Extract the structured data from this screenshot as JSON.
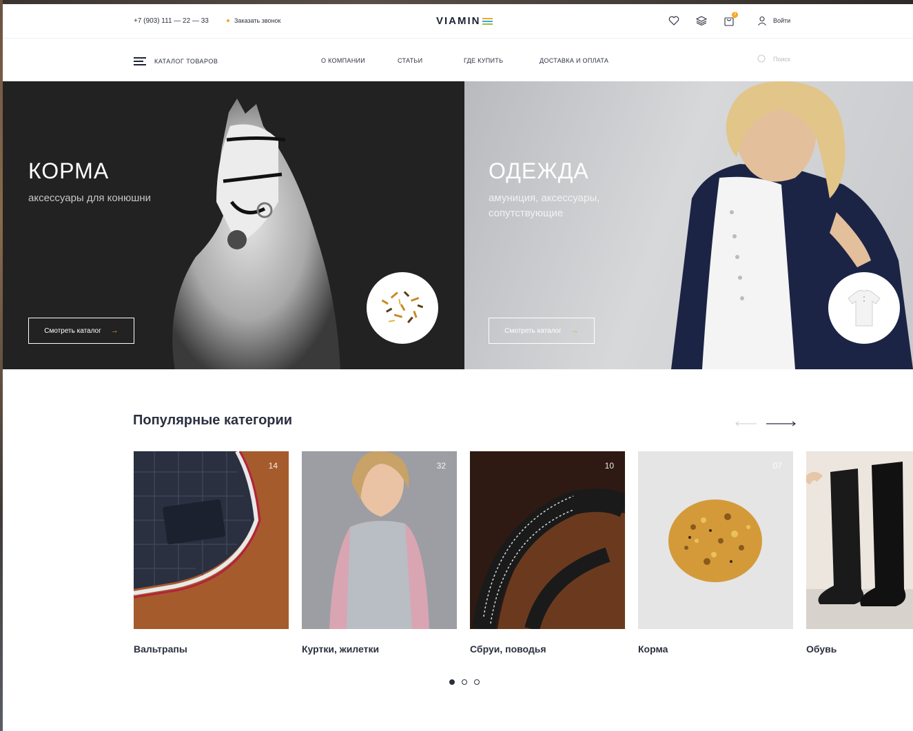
{
  "header": {
    "phone": "+7 (903) 111 — 22 — 33",
    "callback": "Заказать звонок",
    "logo": "VIAMIN",
    "logo_colors": [
      "#f5a623",
      "#35a9e0",
      "#8cc63f"
    ],
    "cart_count": "2",
    "login": "Войти",
    "icons": [
      "heart-icon",
      "layers-icon",
      "cart-icon",
      "user-icon"
    ]
  },
  "nav": {
    "catalog": "КАТАЛОГ ТОВАРОВ",
    "items": [
      "О КОМПАНИИ",
      "СТАТЬИ",
      "ГДЕ КУПИТЬ",
      "ДОСТАВКА И ОПЛАТА"
    ],
    "search_placeholder": "Поиск"
  },
  "hero": {
    "left": {
      "title": "КОРМА",
      "subtitle": "аксессуары для конюшни",
      "button": "Смотреть каталог"
    },
    "right": {
      "title": "ОДЕЖДА",
      "subtitle": "амуниция, аксессуары, сопутствующие",
      "button": "Смотреть каталог"
    }
  },
  "categories": {
    "title": "Популярные категории",
    "items": [
      {
        "label": "Вальтрапы",
        "count": "14"
      },
      {
        "label": "Куртки, жилетки",
        "count": "32"
      },
      {
        "label": "Сбруи, поводья",
        "count": "10"
      },
      {
        "label": "Корма",
        "count": "07"
      },
      {
        "label": "Обувь",
        "count": ""
      }
    ],
    "pages": 3,
    "active_page": 1
  },
  "colors": {
    "accent": "#f5a623",
    "text": "#2b3040",
    "hero_dark": "#222222"
  }
}
